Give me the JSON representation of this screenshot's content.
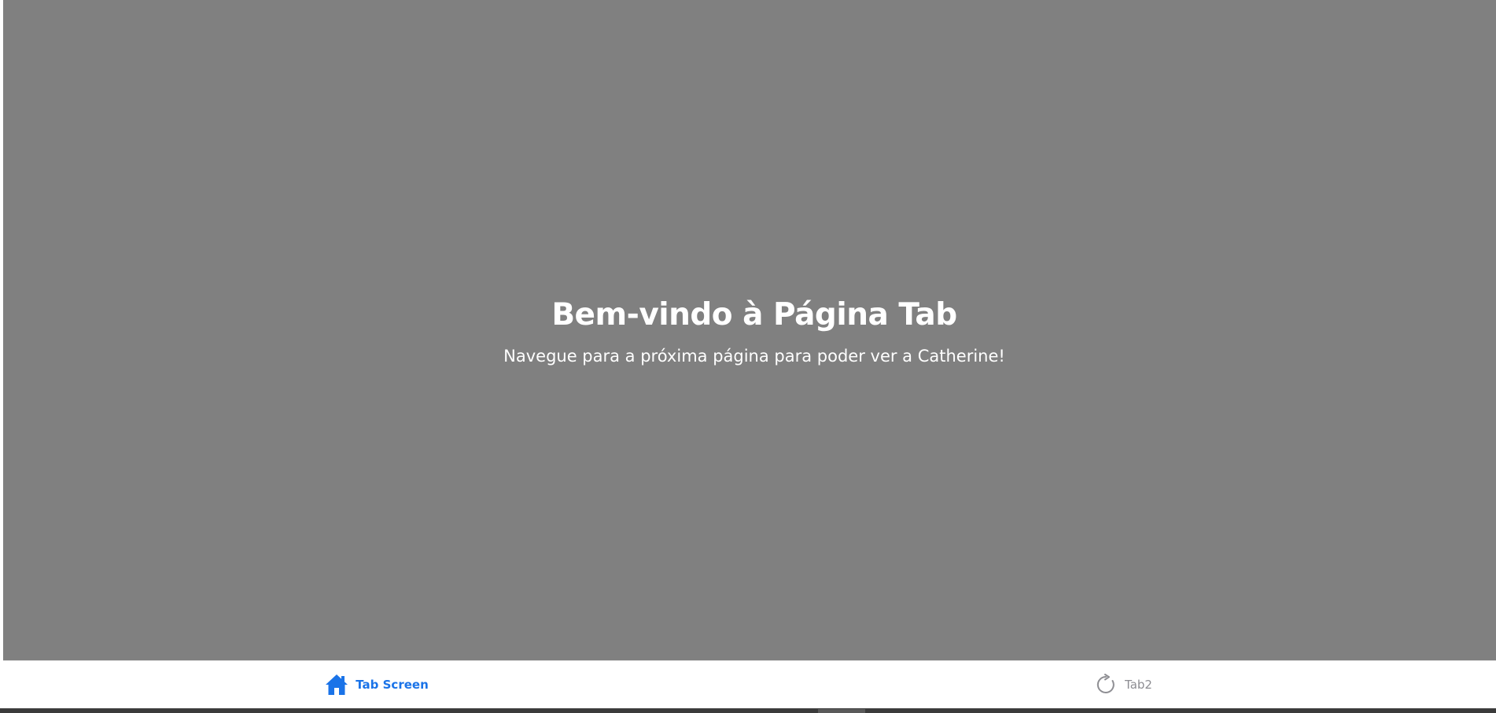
{
  "main": {
    "title": "Bem-vindo à Página Tab",
    "subtitle": "Navegue para a próxima página para poder ver a Catherine!"
  },
  "tab_bar": {
    "tabs": [
      {
        "label": "Tab Screen",
        "icon": "home-icon",
        "active": true
      },
      {
        "label": "Tab2",
        "icon": "refresh-icon",
        "active": false
      }
    ]
  },
  "colors": {
    "content_background": "#808080",
    "active_tab": "#1a73e8",
    "inactive_tab": "#8e8e93",
    "tab_bar_background": "#ffffff"
  }
}
